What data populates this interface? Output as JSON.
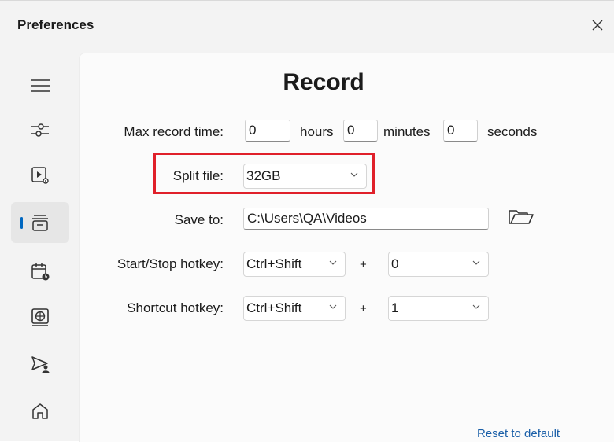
{
  "window": {
    "title": "Preferences"
  },
  "sidebar": {
    "items": [
      {
        "icon": "menu-icon",
        "active": false
      },
      {
        "icon": "sliders-icon",
        "active": false
      },
      {
        "icon": "video-settings-icon",
        "active": false
      },
      {
        "icon": "record-tray-icon",
        "active": true
      },
      {
        "icon": "calendar-clock-icon",
        "active": false
      },
      {
        "icon": "web-globe-icon",
        "active": false
      },
      {
        "icon": "send-user-icon",
        "active": false
      },
      {
        "icon": "home-icon",
        "active": false
      }
    ],
    "accent_color": "#0067c0"
  },
  "record": {
    "heading": "Record",
    "max_record_time": {
      "label": "Max record time:",
      "hours_value": "0",
      "hours_unit": "hours",
      "minutes_value": "0",
      "minutes_unit": "minutes",
      "seconds_value": "0",
      "seconds_unit": "seconds"
    },
    "split_file": {
      "label": "Split file:",
      "value": "32GB"
    },
    "save_to": {
      "label": "Save to:",
      "value": "C:\\Users\\QA\\Videos"
    },
    "start_stop_hotkey": {
      "label": "Start/Stop hotkey:",
      "modifier": "Ctrl+Shift",
      "plus": "+",
      "key": "0"
    },
    "shortcut_hotkey": {
      "label": "Shortcut hotkey:",
      "modifier": "Ctrl+Shift",
      "plus": "+",
      "key": "1"
    },
    "reset_label": "Reset to default"
  },
  "colors": {
    "highlight": "#e0202a",
    "link": "#1a5fa8"
  }
}
